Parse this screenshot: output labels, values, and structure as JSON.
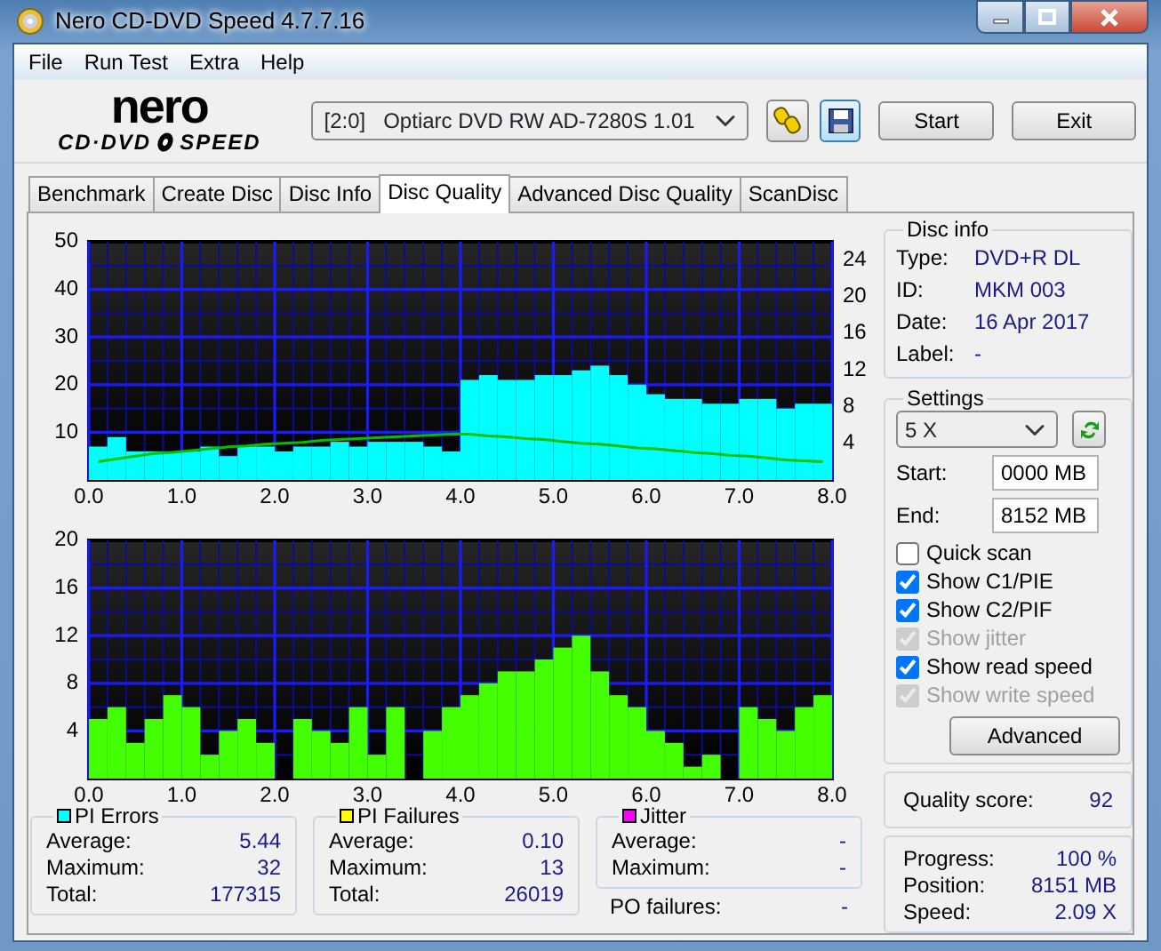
{
  "window": {
    "title": "Nero CD-DVD Speed 4.7.7.16"
  },
  "menu": [
    {
      "label": "File"
    },
    {
      "label": "Run Test"
    },
    {
      "label": "Extra"
    },
    {
      "label": "Help"
    }
  ],
  "logo": {
    "wordmark": "nero",
    "subtitle_left": "CD·DVD",
    "subtitle_right": "SPEED"
  },
  "drive": {
    "id": "[2:0]",
    "name": "Optiarc DVD RW AD-7280S 1.01"
  },
  "toolbar_buttons": [
    {
      "label": "Start"
    },
    {
      "label": "Exit"
    }
  ],
  "tabs": [
    {
      "label": "Benchmark",
      "selected": false
    },
    {
      "label": "Create Disc",
      "selected": false
    },
    {
      "label": "Disc Info",
      "selected": false
    },
    {
      "label": "Disc Quality",
      "selected": true
    },
    {
      "label": "Advanced Disc Quality",
      "selected": false
    },
    {
      "label": "ScanDisc",
      "selected": false
    }
  ],
  "charts": [
    {
      "chart_data": {
        "type": "bar",
        "grid": true,
        "xlim": [
          0,
          8
        ],
        "ylim": [
          0,
          50
        ],
        "xticks": [
          {
            "value": 0,
            "label": "0.0"
          },
          {
            "value": 1,
            "label": "1.0"
          },
          {
            "value": 2,
            "label": "2.0"
          },
          {
            "value": 3,
            "label": "3.0"
          },
          {
            "value": 4,
            "label": "4.0"
          },
          {
            "value": 5,
            "label": "5.0"
          },
          {
            "value": 6,
            "label": "6.0"
          },
          {
            "value": 7,
            "label": "7.0"
          },
          {
            "value": 8,
            "label": "8.0"
          }
        ],
        "yticks": [
          10,
          20,
          30,
          40,
          50
        ],
        "x": [
          0.1,
          0.3,
          0.5,
          0.7,
          0.9,
          1.1,
          1.3,
          1.5,
          1.7,
          1.9,
          2.1,
          2.3,
          2.5,
          2.7,
          2.9,
          3.1,
          3.3,
          3.5,
          3.7,
          3.9,
          4.1,
          4.3,
          4.5,
          4.7,
          4.9,
          5.1,
          5.3,
          5.5,
          5.7,
          5.9,
          6.1,
          6.3,
          6.5,
          6.7,
          6.9,
          7.1,
          7.3,
          7.5,
          7.7,
          7.9
        ],
        "series": [
          {
            "color": "#00ffff",
            "values": [
              7,
              9,
              6,
              6,
              6,
              6,
              7,
              5,
              7,
              7,
              6,
              7,
              7,
              8,
              7,
              8,
              8,
              8,
              7,
              6,
              21,
              22,
              21,
              21,
              22,
              22,
              23,
              24,
              22,
              20,
              18,
              17,
              17,
              16,
              16,
              17,
              17,
              15,
              16,
              16
            ]
          }
        ]
      }
    },
    {
      "chart_data": {
        "type": "line",
        "xlim": [
          0,
          8
        ],
        "ylim": [
          0,
          26
        ],
        "yticks": [
          4,
          8,
          12,
          16,
          20,
          24
        ],
        "x": [
          0.1,
          0.3,
          0.5,
          0.7,
          0.9,
          1.1,
          1.3,
          1.5,
          1.7,
          1.9,
          2.1,
          2.3,
          2.5,
          2.7,
          2.9,
          3.1,
          3.3,
          3.5,
          3.7,
          3.9,
          4.1,
          4.3,
          4.5,
          4.7,
          4.9,
          5.1,
          5.3,
          5.5,
          5.7,
          5.9,
          6.1,
          6.3,
          6.5,
          6.7,
          6.9,
          7.1,
          7.3,
          7.5,
          7.7,
          7.9
        ],
        "series": [
          {
            "color": "#00c000",
            "values": [
              2.0,
              2.3,
              2.6,
              2.9,
              3.0,
              3.2,
              3.4,
              3.6,
              3.7,
              3.9,
              4.0,
              4.1,
              4.3,
              4.4,
              4.5,
              4.6,
              4.7,
              4.8,
              4.9,
              5.0,
              5.0,
              4.8,
              4.7,
              4.5,
              4.4,
              4.2,
              4.0,
              3.9,
              3.7,
              3.5,
              3.4,
              3.2,
              3.0,
              2.9,
              2.7,
              2.6,
              2.4,
              2.2,
              2.1,
              2.0
            ]
          }
        ]
      }
    },
    {
      "chart_data": {
        "type": "bar",
        "grid": true,
        "xlim": [
          0,
          8
        ],
        "ylim": [
          0,
          20
        ],
        "xticks": [
          {
            "value": 0,
            "label": "0.0"
          },
          {
            "value": 1,
            "label": "1.0"
          },
          {
            "value": 2,
            "label": "2.0"
          },
          {
            "value": 3,
            "label": "3.0"
          },
          {
            "value": 4,
            "label": "4.0"
          },
          {
            "value": 5,
            "label": "5.0"
          },
          {
            "value": 6,
            "label": "6.0"
          },
          {
            "value": 7,
            "label": "7.0"
          },
          {
            "value": 8,
            "label": "8.0"
          }
        ],
        "yticks": [
          4,
          8,
          12,
          16,
          20
        ],
        "x": [
          0.1,
          0.3,
          0.5,
          0.7,
          0.9,
          1.1,
          1.3,
          1.5,
          1.7,
          1.9,
          2.1,
          2.3,
          2.5,
          2.7,
          2.9,
          3.1,
          3.3,
          3.5,
          3.7,
          3.9,
          4.1,
          4.3,
          4.5,
          4.7,
          4.9,
          5.1,
          5.3,
          5.5,
          5.7,
          5.9,
          6.1,
          6.3,
          6.5,
          6.7,
          6.9,
          7.1,
          7.3,
          7.5,
          7.7,
          7.9
        ],
        "series": [
          {
            "color": "#44ff00",
            "values": [
              5,
              6,
              3,
              5,
              7,
              6,
              2,
              4,
              5,
              3,
              0,
              5,
              4,
              3,
              6,
              2,
              6,
              0,
              4,
              6,
              7,
              8,
              9,
              9,
              10,
              11,
              12,
              9,
              7,
              6,
              4,
              3,
              1,
              2,
              0,
              6,
              5,
              4,
              6,
              7
            ]
          }
        ]
      }
    }
  ],
  "stats": [
    {
      "title": "PI Errors",
      "color": "#00ffff",
      "rows": [
        {
          "label": "Average:",
          "value": "5.44"
        },
        {
          "label": "Maximum:",
          "value": "32"
        },
        {
          "label": "Total:",
          "value": "177315"
        }
      ]
    },
    {
      "title": "PI Failures",
      "color": "#ffff00",
      "rows": [
        {
          "label": "Average:",
          "value": "0.10"
        },
        {
          "label": "Maximum:",
          "value": "13"
        },
        {
          "label": "Total:",
          "value": "26019"
        }
      ]
    },
    {
      "title": "Jitter",
      "color": "#ff00ff",
      "rows": [
        {
          "label": "Average:",
          "value": "-"
        },
        {
          "label": "Maximum:",
          "value": "-"
        }
      ]
    }
  ],
  "po_failures": {
    "label": "PO failures:",
    "value": "-"
  },
  "disc_info": {
    "title": "Disc info",
    "rows": [
      {
        "label": "Type:",
        "value": "DVD+R DL"
      },
      {
        "label": "ID:",
        "value": "MKM 003"
      },
      {
        "label": "Date:",
        "value": "16 Apr 2017"
      },
      {
        "label": "Label:",
        "value": "-"
      }
    ]
  },
  "settings": {
    "title": "Settings",
    "speed": "5 X",
    "start": {
      "label": "Start:",
      "value": "0000 MB"
    },
    "end": {
      "label": "End:",
      "value": "8152 MB"
    },
    "options": [
      {
        "label": "Quick scan",
        "checked": false,
        "disabled": false
      },
      {
        "label": "Show C1/PIE",
        "checked": true,
        "disabled": false
      },
      {
        "label": "Show C2/PIF",
        "checked": true,
        "disabled": false
      },
      {
        "label": "Show jitter",
        "checked": true,
        "disabled": true
      },
      {
        "label": "Show read speed",
        "checked": true,
        "disabled": false
      },
      {
        "label": "Show write speed",
        "checked": true,
        "disabled": true
      }
    ],
    "advanced_button": "Advanced"
  },
  "quality": {
    "label": "Quality score:",
    "value": "92"
  },
  "progress": [
    {
      "label": "Progress:",
      "value": "100 %"
    },
    {
      "label": "Position:",
      "value": "8151 MB"
    },
    {
      "label": "Speed:",
      "value": "2.09 X"
    }
  ]
}
